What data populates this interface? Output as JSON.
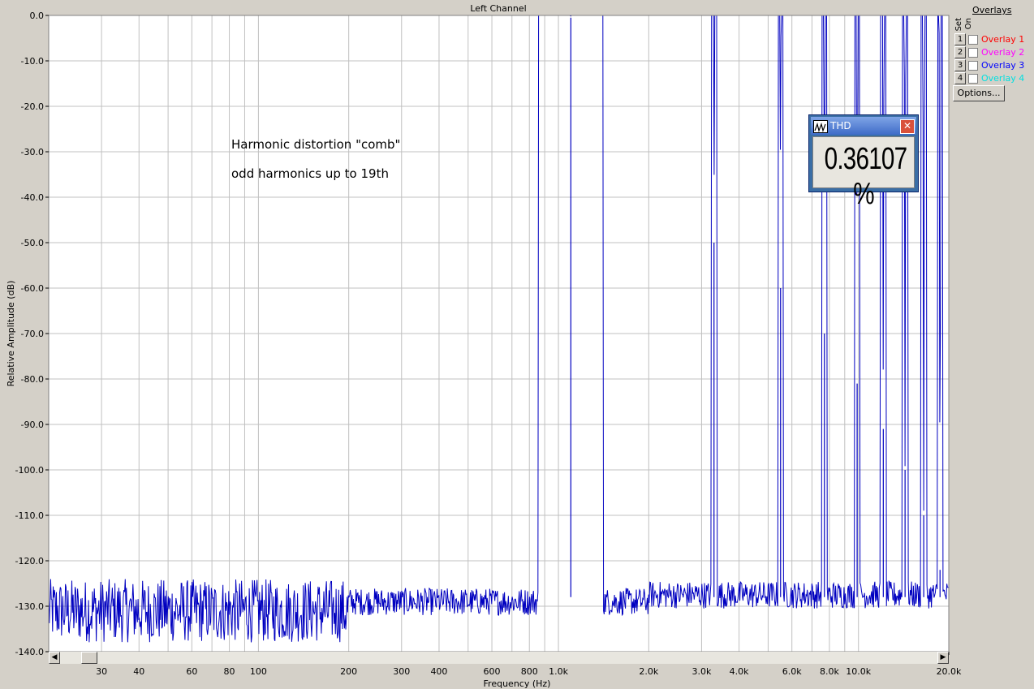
{
  "chart_data": {
    "type": "line",
    "title": "Left Channel",
    "xlabel": "Frequency (Hz)",
    "ylabel": "Relative Amplitude (dB)",
    "x_scale": "log",
    "xlim": [
      20,
      20000
    ],
    "ylim": [
      -140,
      0
    ],
    "grid": true,
    "x_ticks": [
      "30",
      "40",
      "60",
      "80",
      "100",
      "200",
      "300",
      "400",
      "600",
      "800",
      "1.0k",
      "2.0k",
      "3.0k",
      "4.0k",
      "6.0k",
      "8.0k",
      "10.0k",
      "20.0k"
    ],
    "x_tick_values": [
      30,
      40,
      60,
      80,
      100,
      200,
      300,
      400,
      600,
      800,
      1000,
      2000,
      3000,
      4000,
      6000,
      8000,
      10000,
      20000
    ],
    "y_ticks": [
      "0.0",
      "-10.0",
      "-20.0",
      "-30.0",
      "-40.0",
      "-50.0",
      "-60.0",
      "-70.0",
      "-80.0",
      "-90.0",
      "-100.0",
      "-110.0",
      "-120.0",
      "-130.0",
      "-140.0"
    ],
    "y_tick_values": [
      0,
      -10,
      -20,
      -30,
      -40,
      -50,
      -60,
      -70,
      -80,
      -90,
      -100,
      -110,
      -120,
      -130,
      -140
    ],
    "series": [
      {
        "color": "#0000c0",
        "noise_floor_db": -131,
        "peaks": [
          {
            "x": 1100,
            "y": -0.5
          },
          {
            "x": 3300,
            "y": -50
          },
          {
            "x": 5500,
            "y": -60
          },
          {
            "x": 7700,
            "y": -70
          },
          {
            "x": 9900,
            "y": -81
          },
          {
            "x": 12100,
            "y": -91
          },
          {
            "x": 14300,
            "y": -100
          },
          {
            "x": 16500,
            "y": -110
          },
          {
            "x": 18700,
            "y": -122
          }
        ]
      }
    ],
    "annotations": [
      "Harmonic distortion \"comb\"",
      "odd harmonics up to 19th"
    ]
  },
  "overlays": {
    "title": "Overlays",
    "set_label": "Set",
    "on_label": "On",
    "items": [
      {
        "num": "1",
        "label": "Overlay 1",
        "color": "#ff0000"
      },
      {
        "num": "2",
        "label": "Overlay 2",
        "color": "#ff00ff"
      },
      {
        "num": "3",
        "label": "Overlay 3",
        "color": "#0000ff"
      },
      {
        "num": "4",
        "label": "Overlay 4",
        "color": "#00e0e0"
      }
    ],
    "options_label": "Options..."
  },
  "thd": {
    "title": "THD",
    "value": "0.36107 %"
  },
  "colors": {
    "plot_bg": "#ffffff",
    "grid": "#c0c0c0",
    "trace": "#0000c0"
  }
}
